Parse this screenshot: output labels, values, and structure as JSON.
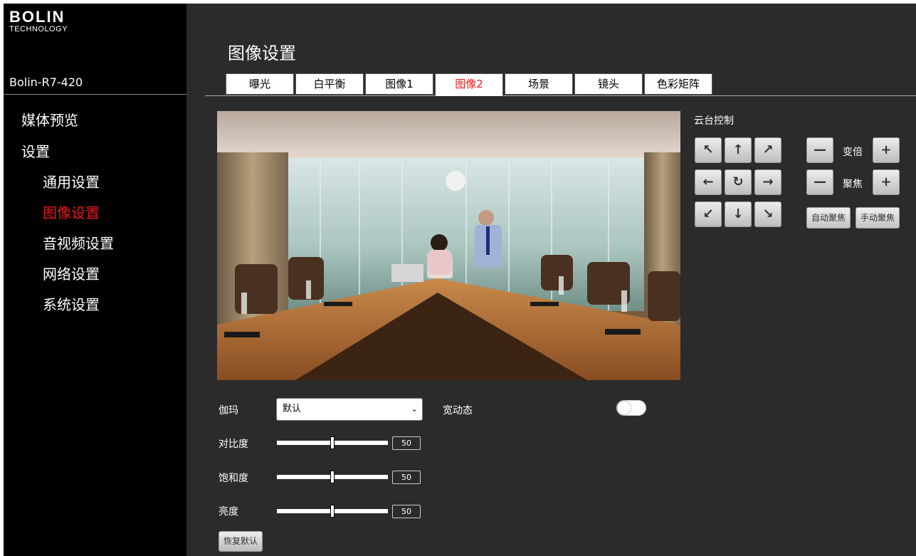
{
  "brand": {
    "line1": "BOLIN",
    "line2": "TECHNOLOGY"
  },
  "device_name": "Bolin-R7-420",
  "sidebar": {
    "items": [
      {
        "label": "媒体预览"
      },
      {
        "label": "设置"
      },
      {
        "label": "通用设置"
      },
      {
        "label": "图像设置",
        "active": true
      },
      {
        "label": "音视频设置"
      },
      {
        "label": "网络设置"
      },
      {
        "label": "系统设置"
      }
    ]
  },
  "page_title": "图像设置",
  "tabs": [
    {
      "label": "曝光"
    },
    {
      "label": "白平衡"
    },
    {
      "label": "图像1"
    },
    {
      "label": "图像2",
      "active": true
    },
    {
      "label": "场景"
    },
    {
      "label": "镜头"
    },
    {
      "label": "色彩矩阵"
    }
  ],
  "ptz": {
    "title": "云台控制",
    "zoom_label": "变倍",
    "focus_label": "聚焦",
    "auto_focus": "自动聚焦",
    "manual_focus": "手动聚焦",
    "icons": {
      "up_left": "↖",
      "up": "↑",
      "up_right": "↗",
      "left": "←",
      "home": "↻",
      "right": "→",
      "down_left": "↙",
      "down": "↓",
      "down_right": "↘",
      "minus": "—",
      "plus": "+"
    }
  },
  "form": {
    "gamma": {
      "label": "伽玛",
      "value": "默认",
      "chevron": "⌄"
    },
    "wdr": {
      "label": "宽动态",
      "on": false
    },
    "contrast": {
      "label": "对比度",
      "value": "50",
      "fraction": 0.5
    },
    "saturation": {
      "label": "饱和度",
      "value": "50",
      "fraction": 0.5
    },
    "brightness": {
      "label": "亮度",
      "value": "50",
      "fraction": 0.5
    },
    "restore_label": "恢复默认"
  },
  "colors": {
    "accent": "#e8191c",
    "sidebar_bg": "#000000",
    "main_bg": "#2b2b2b"
  }
}
